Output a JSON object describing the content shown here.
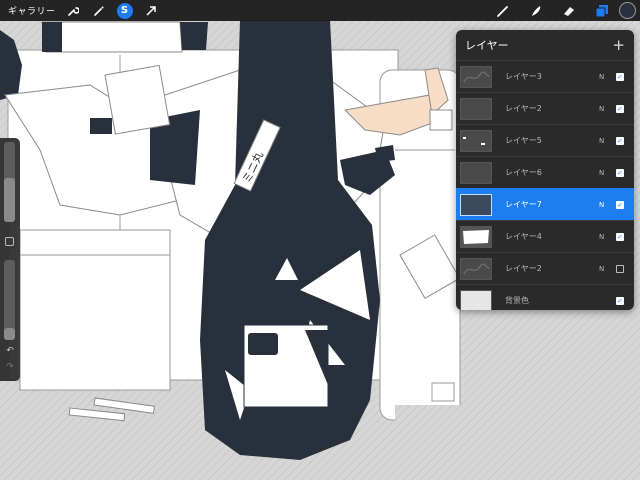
{
  "toolbar": {
    "gallery_label": "ギャラリー",
    "smudge_glyph": "S",
    "left_tools": [
      "wrench-icon",
      "magic-wand-icon",
      "selection-s-icon",
      "transform-arrow-icon"
    ],
    "right_tools": [
      "brush-icon",
      "smudge-icon",
      "eraser-icon",
      "layers-icon",
      "color-icon"
    ],
    "active_accent": "#1f7cf0",
    "current_color": "#27303b"
  },
  "sidebar": {
    "undo_glyph": "↶",
    "redo_glyph": "↷",
    "brush_size_level": 0.55,
    "opacity_level": 0.15
  },
  "layers": {
    "title": "レイヤー",
    "add_glyph": "+",
    "items": [
      {
        "name": "レイヤー3",
        "blend": "N",
        "visible": true,
        "active": false,
        "thumb": "sketch"
      },
      {
        "name": "レイヤー2",
        "blend": "N",
        "visible": true,
        "active": false,
        "thumb": "blank"
      },
      {
        "name": "レイヤー5",
        "blend": "N",
        "visible": true,
        "active": false,
        "thumb": "dots"
      },
      {
        "name": "レイヤー6",
        "blend": "N",
        "visible": true,
        "active": false,
        "thumb": "blank"
      },
      {
        "name": "レイヤー7",
        "blend": "N",
        "visible": true,
        "active": true,
        "thumb": "dark"
      },
      {
        "name": "レイヤー4",
        "blend": "N",
        "visible": true,
        "active": false,
        "thumb": "white"
      },
      {
        "name": "レイヤー2",
        "blend": "N",
        "visible": false,
        "active": false,
        "thumb": "sketch"
      },
      {
        "name": "背景色",
        "blend": "",
        "visible": true,
        "active": false,
        "thumb": "bg"
      }
    ],
    "check_glyph": "✓",
    "active_color": "#1c7ef0"
  },
  "canvas": {
    "label_text": "ミニ丸",
    "dark_fill": "#27303b",
    "skin_color": "#f7dcc6"
  }
}
